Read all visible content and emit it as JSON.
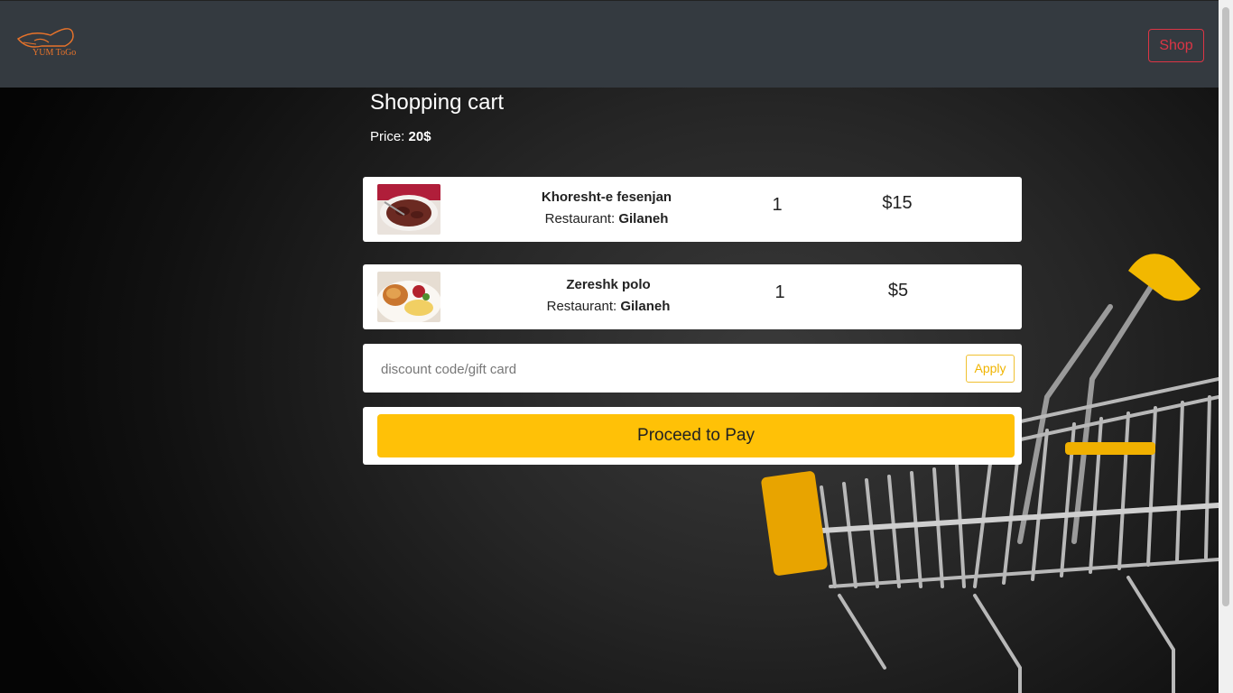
{
  "navbar": {
    "logo_text": "YUM ToGo",
    "shop_label": "Shop",
    "shop_color": "#dc3545"
  },
  "cart": {
    "title": "Shopping cart",
    "price_label": "Price:",
    "price_value": "20$",
    "items": [
      {
        "name": "Khoresht-e fesenjan",
        "restaurant_label": "Restaurant:",
        "restaurant": "Gilaneh",
        "quantity": "1",
        "price": "$15",
        "image": "stew-dish-image"
      },
      {
        "name": "Zereshk polo",
        "restaurant_label": "Restaurant:",
        "restaurant": "Gilaneh",
        "quantity": "1",
        "price": "$5",
        "image": "rice-chicken-dish-image"
      }
    ]
  },
  "discount": {
    "placeholder": "discount code/gift card",
    "value": "",
    "apply_label": "Apply"
  },
  "pay": {
    "label": "Proceed to Pay",
    "color": "#ffc107"
  }
}
